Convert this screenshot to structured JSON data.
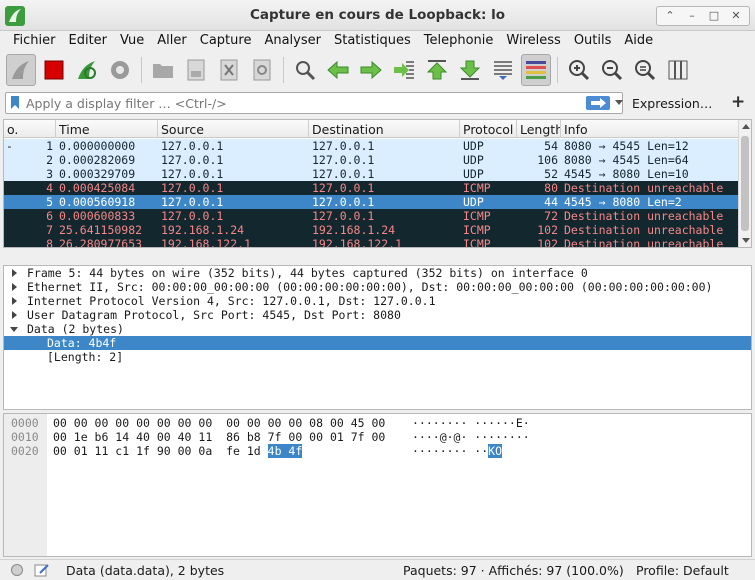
{
  "window": {
    "title": "Capture en cours de Loopback: lo",
    "buttons": [
      "⌃",
      "–",
      "□",
      "✕"
    ]
  },
  "menu": [
    "Fichier",
    "Editer",
    "Vue",
    "Aller",
    "Capture",
    "Analyser",
    "Statistiques",
    "Telephonie",
    "Wireless",
    "Outils",
    "Aide"
  ],
  "toolbar": {
    "icons": [
      "shark-fin-icon",
      "stop-capture-icon",
      "restart-capture-icon",
      "capture-options-icon",
      "open-file-icon",
      "save-file-icon",
      "close-file-icon",
      "reload-file-icon",
      "find-packet-icon",
      "go-back-icon",
      "go-forward-icon",
      "go-to-packet-icon",
      "go-first-icon",
      "go-last-icon",
      "autoscroll-icon",
      "colorize-icon",
      "zoom-in-icon",
      "zoom-out-icon",
      "zoom-normal-icon",
      "resize-columns-icon"
    ]
  },
  "filter": {
    "placeholder": "Apply a display filter … <Ctrl-/>",
    "expression_label": "Expression…",
    "plus_label": "+"
  },
  "packet_list": {
    "columns": [
      "o.",
      "Time",
      "Source",
      "Destination",
      "Protocol",
      "Length",
      "Info"
    ],
    "rows": [
      {
        "no": "1",
        "time": "0.000000000",
        "src": "127.0.0.1",
        "dst": "127.0.0.1",
        "proto": "UDP",
        "len": "54",
        "info": "8080 → 4545 Len=12",
        "kind": "udp",
        "mark": "-"
      },
      {
        "no": "2",
        "time": "0.000282069",
        "src": "127.0.0.1",
        "dst": "127.0.0.1",
        "proto": "UDP",
        "len": "106",
        "info": "8080 → 4545 Len=64",
        "kind": "udp",
        "mark": ""
      },
      {
        "no": "3",
        "time": "0.000329709",
        "src": "127.0.0.1",
        "dst": "127.0.0.1",
        "proto": "UDP",
        "len": "52",
        "info": "4545 → 8080 Len=10",
        "kind": "udp",
        "mark": ""
      },
      {
        "no": "4",
        "time": "0.000425084",
        "src": "127.0.0.1",
        "dst": "127.0.0.1",
        "proto": "ICMP",
        "len": "80",
        "info": "Destination unreachable",
        "kind": "icmp",
        "mark": ""
      },
      {
        "no": "5",
        "time": "0.000560918",
        "src": "127.0.0.1",
        "dst": "127.0.0.1",
        "proto": "UDP",
        "len": "44",
        "info": "4545 → 8080 Len=2",
        "kind": "selrow",
        "mark": ""
      },
      {
        "no": "6",
        "time": "0.000600833",
        "src": "127.0.0.1",
        "dst": "127.0.0.1",
        "proto": "ICMP",
        "len": "72",
        "info": "Destination unreachable",
        "kind": "icmp",
        "mark": ""
      },
      {
        "no": "7",
        "time": "25.641150982",
        "src": "192.168.1.24",
        "dst": "192.168.1.24",
        "proto": "ICMP",
        "len": "102",
        "info": "Destination unreachable",
        "kind": "icmp",
        "mark": ""
      },
      {
        "no": "8",
        "time": "26.280977653",
        "src": "192.168.122.1",
        "dst": "192.168.122.1",
        "proto": "ICMP",
        "len": "102",
        "info": "Destination unreachable",
        "kind": "icmp",
        "mark": ""
      }
    ]
  },
  "details": [
    {
      "text": "Frame 5: 44 bytes on wire (352 bits), 44 bytes captured (352 bits) on interface 0",
      "tri": "right",
      "level": 0,
      "selected": false
    },
    {
      "text": "Ethernet II, Src: 00:00:00_00:00:00 (00:00:00:00:00:00), Dst: 00:00:00_00:00:00 (00:00:00:00:00:00)",
      "tri": "right",
      "level": 0,
      "selected": false
    },
    {
      "text": "Internet Protocol Version 4, Src: 127.0.0.1, Dst: 127.0.0.1",
      "tri": "right",
      "level": 0,
      "selected": false
    },
    {
      "text": "User Datagram Protocol, Src Port: 4545, Dst Port: 8080",
      "tri": "right",
      "level": 0,
      "selected": false
    },
    {
      "text": "Data (2 bytes)",
      "tri": "down",
      "level": 0,
      "selected": false
    },
    {
      "text": "Data: 4b4f",
      "tri": "",
      "level": 1,
      "selected": true
    },
    {
      "text": "[Length: 2]",
      "tri": "",
      "level": 1,
      "selected": false
    }
  ],
  "bytes": [
    {
      "offset": "0000",
      "hex": "00 00 00 00 00 00 00 00  00 00 00 00 08 00 45 00",
      "hex_hl": "",
      "ascii": "········ ······E·",
      "ascii_hl": ""
    },
    {
      "offset": "0010",
      "hex": "00 1e b6 14 40 00 40 11  86 b8 7f 00 00 01 7f 00",
      "hex_hl": "",
      "ascii": "····@·@· ········",
      "ascii_hl": ""
    },
    {
      "offset": "0020",
      "hex": "00 01 11 c1 1f 90 00 0a  fe 1d ",
      "hex_hl": "4b 4f",
      "ascii": "········ ··",
      "ascii_hl": "KO"
    }
  ],
  "status": {
    "field_info": "Data (data.data), 2 bytes",
    "packets": "Paquets: 97 · Affichés: 97 (100.0%)",
    "profile": "Profile: Default"
  }
}
